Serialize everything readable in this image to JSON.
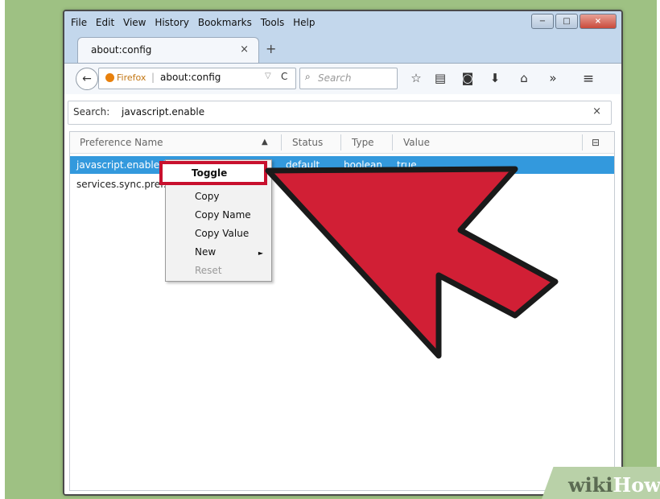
{
  "menu": [
    "File",
    "Edit",
    "View",
    "History",
    "Bookmarks",
    "Tools",
    "Help"
  ],
  "tab": {
    "title": "about:config",
    "close": "×",
    "new_tab": "+"
  },
  "urlbar": {
    "identity": "Firefox",
    "url": "about:config",
    "dropdown": "▽",
    "reload": "C"
  },
  "searchbar": {
    "placeholder": "Search"
  },
  "filter": {
    "label": "Search:",
    "value": "javascript.enable",
    "clear": "×"
  },
  "table": {
    "columns": [
      "Preference Name",
      "Status",
      "Type",
      "Value"
    ],
    "sort_indicator": "▲",
    "rows": [
      {
        "name": "javascript.enabled",
        "status": "default",
        "type": "boolean",
        "value": "true"
      },
      {
        "name": "services.sync.prefs.",
        "status": "",
        "type": "",
        "value": ""
      }
    ]
  },
  "context_menu": {
    "items": [
      "Toggle",
      "Copy",
      "Copy Name",
      "Copy Value",
      "New",
      "Reset"
    ],
    "submenu_arrow": "►"
  },
  "window_controls": [
    "−",
    "□",
    "×"
  ],
  "watermark": {
    "wiki": "wiki",
    "how": "How"
  },
  "colors": {
    "highlight": "#3399dd",
    "arrow_red": "#d11f35",
    "frame_green": "#9ec183"
  },
  "icons": [
    "back-icon",
    "firefox-icon",
    "search-icon",
    "star-icon",
    "bookmarks-list-icon",
    "pocket-icon",
    "download-icon",
    "home-icon",
    "overflow-icon",
    "menu-icon",
    "column-picker-icon"
  ]
}
